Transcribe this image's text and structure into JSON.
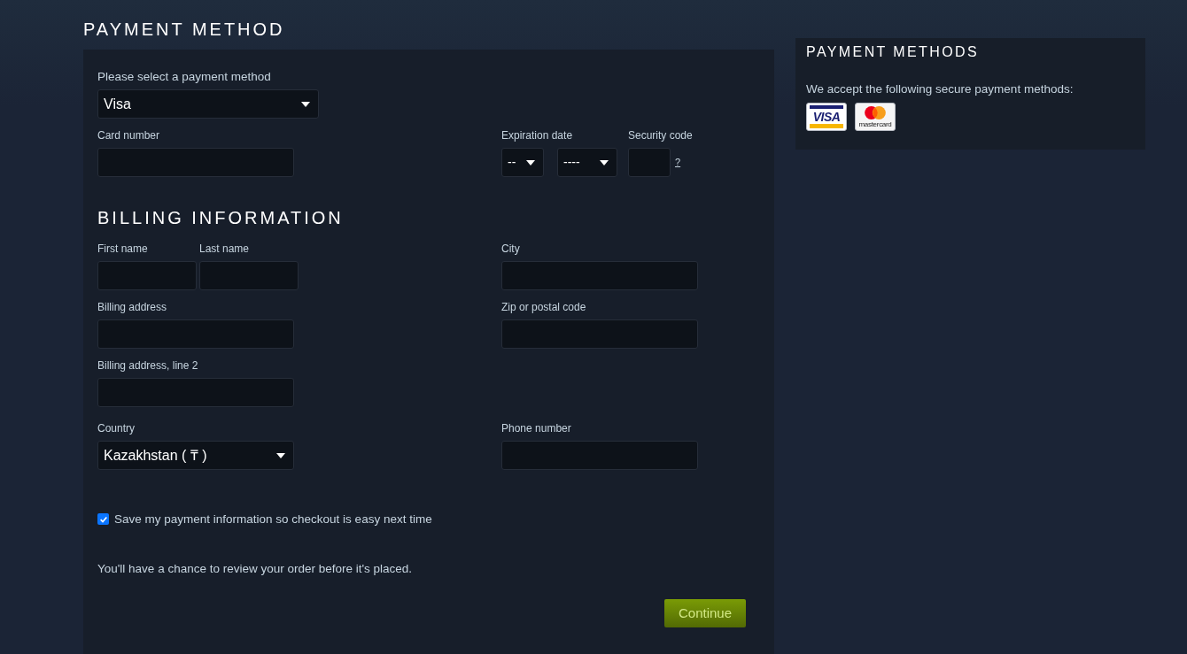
{
  "page_title": "PAYMENT METHOD",
  "payment_method": {
    "label": "Please select a payment method",
    "kind": "select",
    "value": "Visa"
  },
  "card_row": {
    "card_number": {
      "label": "Card number",
      "kind": "text"
    },
    "expiration": {
      "label": "Expiration date",
      "month": "--",
      "year": "----"
    },
    "security_code": {
      "label": "Security code",
      "help_link": "?"
    }
  },
  "billing": {
    "heading": "BILLING INFORMATION",
    "rows": [
      {
        "left": [
          {
            "label": "First name",
            "kind": "text"
          },
          {
            "label": "Last name",
            "kind": "text"
          }
        ],
        "right": [
          {
            "label": "City",
            "kind": "text"
          }
        ]
      },
      {
        "left": [
          {
            "label": "Billing address",
            "kind": "text"
          }
        ],
        "right": [
          {
            "label": "Zip or postal code",
            "kind": "text"
          }
        ]
      },
      {
        "left": [
          {
            "label": "Billing address, line 2",
            "kind": "text"
          }
        ]
      },
      {
        "left": [
          {
            "label": "Country",
            "kind": "select",
            "value": "Kazakhstan ( ₸ )"
          }
        ],
        "right": [
          {
            "label": "Phone number",
            "kind": "text"
          }
        ]
      }
    ]
  },
  "save_info": {
    "label": "Save my payment information so checkout is easy next time",
    "checked": true
  },
  "review_note": "You'll have a chance to review your order before it's placed.",
  "continue_button": "Continue",
  "sidebar": {
    "title": "PAYMENT METHODS",
    "text": "We accept the following secure payment methods:",
    "cards": [
      {
        "kind": "visa",
        "wordmark": "VISA"
      },
      {
        "kind": "mastercard",
        "wordmark": "mastercard"
      }
    ]
  }
}
